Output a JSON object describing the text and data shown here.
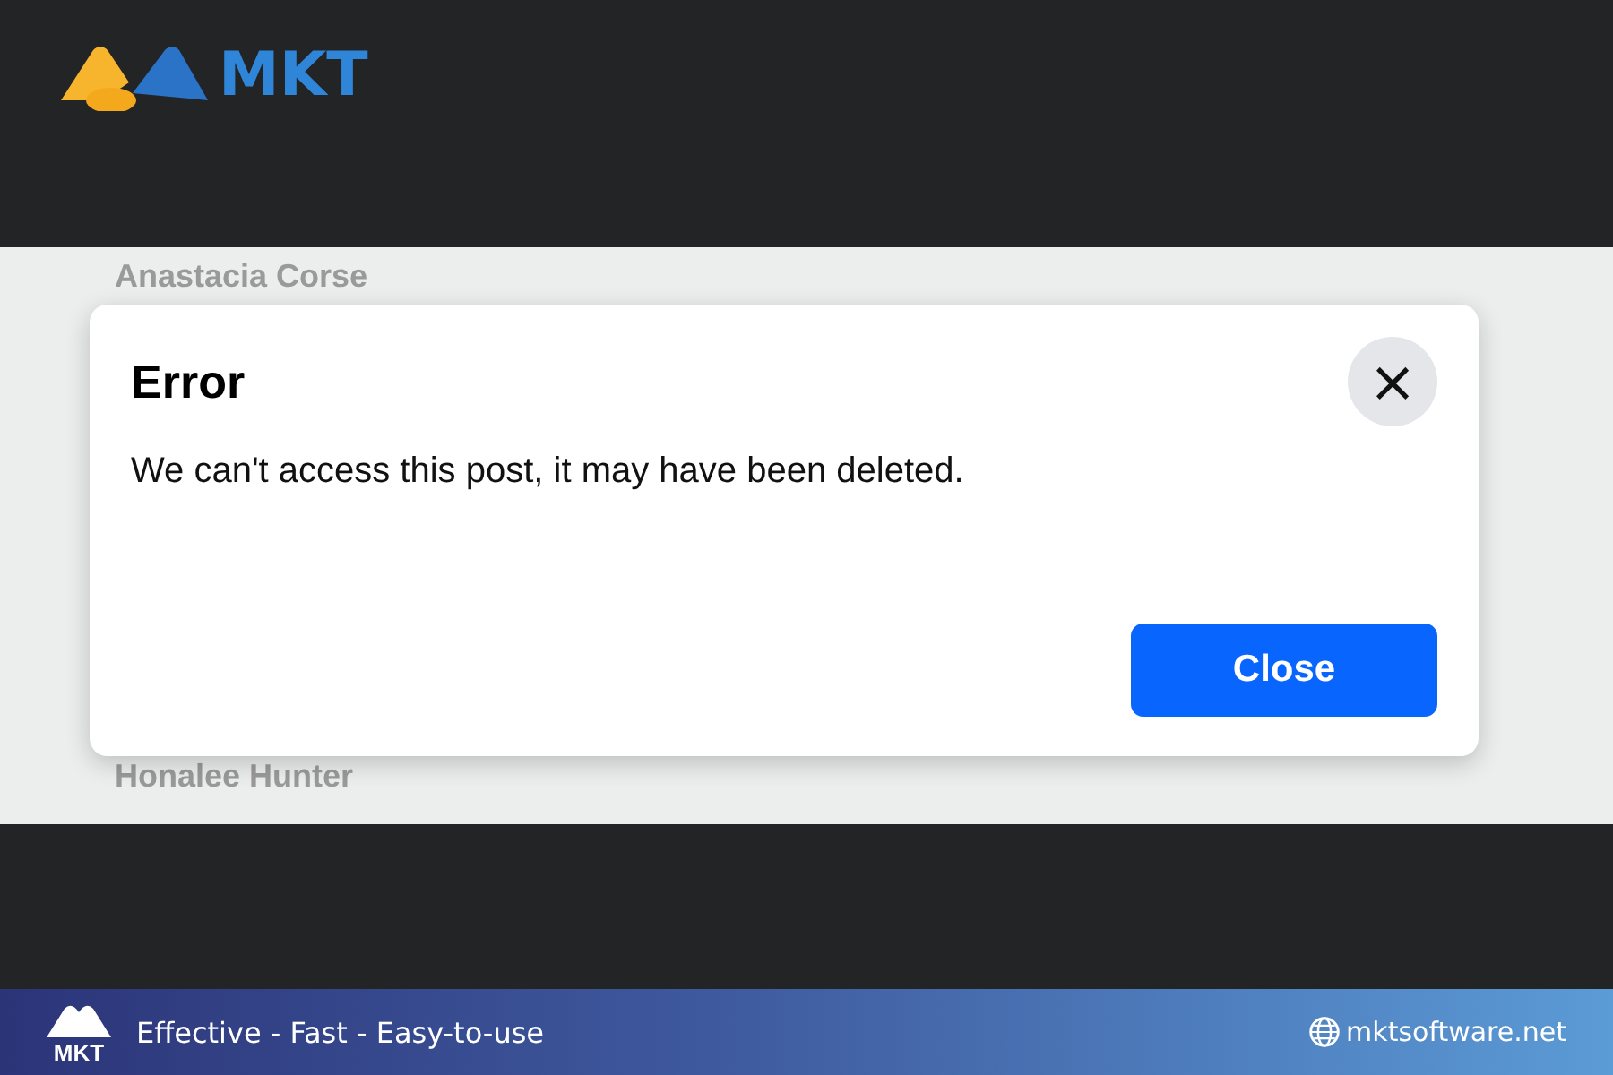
{
  "header": {
    "logo": "MKT"
  },
  "background": {
    "names": [
      "Anastacia Corse",
      "Honalee Hunter"
    ]
  },
  "dialog": {
    "title": "Error",
    "message": "We can't access this post, it may have been deleted.",
    "close_icon": "×",
    "button": "Close"
  },
  "banner": {
    "logo": "MKT",
    "slogan": "Effective - Fast - Easy-to-use",
    "website": "mktsoftware.net"
  }
}
